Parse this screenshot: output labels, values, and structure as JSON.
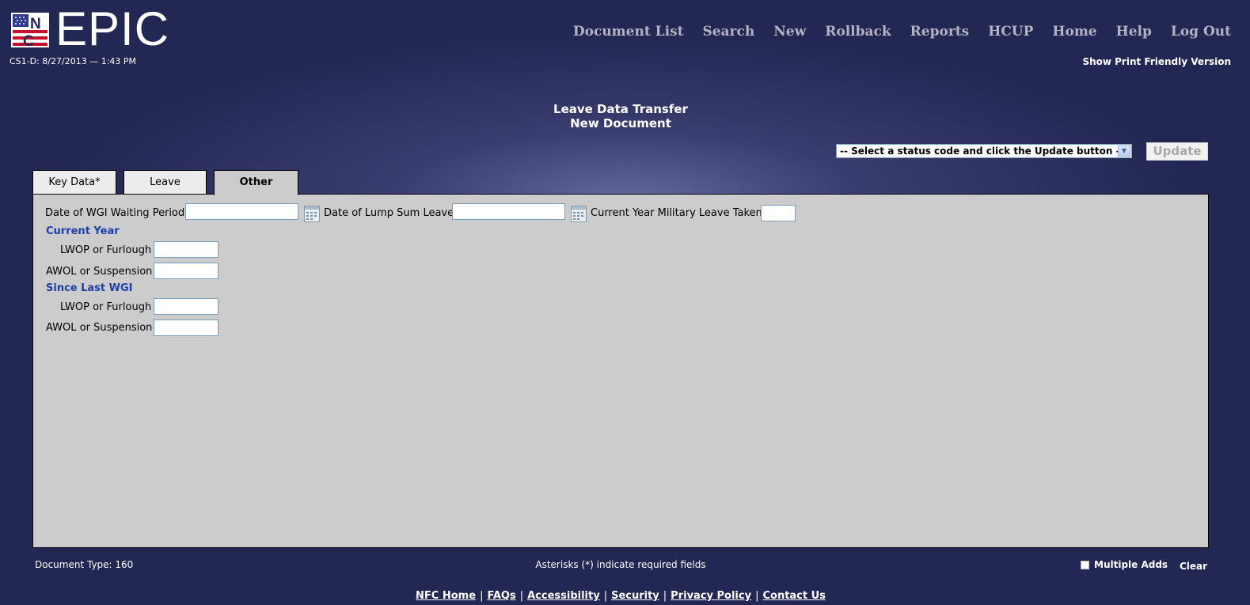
{
  "header": {
    "logo_text": "EPIC",
    "session": "CS1-D: 8/27/2013 — 1:43 PM",
    "nav": [
      "Document List",
      "Search",
      "New",
      "Rollback",
      "Reports",
      "HCUP",
      "Home",
      "Help",
      "Log Out"
    ],
    "print_link": "Show Print Friendly Version"
  },
  "page": {
    "title": "Leave Data Transfer",
    "subtitle": "New Document"
  },
  "status": {
    "select_value": "-- Select a status code and click the Update button --",
    "update_label": "Update"
  },
  "tabs": [
    {
      "label": "Key Data*",
      "active": false
    },
    {
      "label": "Leave",
      "active": false
    },
    {
      "label": "Other",
      "active": true
    }
  ],
  "form": {
    "wgi_waiting_label": "Date of WGI Waiting Period",
    "wgi_waiting_value": "",
    "lump_sum_label": "Date of Lump Sum Leave",
    "lump_sum_value": "",
    "military_label": "Current Year Military Leave Taken",
    "military_value": "",
    "current_year": {
      "heading": "Current Year",
      "lwop_label": "LWOP or Furlough",
      "lwop_value": "",
      "awol_label": "AWOL or Suspension",
      "awol_value": ""
    },
    "since_last_wgi": {
      "heading": "Since Last WGI",
      "lwop_label": "LWOP or Furlough",
      "lwop_value": "",
      "awol_label": "AWOL or Suspension",
      "awol_value": ""
    }
  },
  "footer": {
    "doc_type": "Document Type: 160",
    "required_note": "Asterisks (*) indicate required fields",
    "multiple_adds": "Multiple Adds",
    "clear": "Clear",
    "links": [
      "NFC Home",
      "FAQs",
      "Accessibility",
      "Security",
      "Privacy Policy",
      "Contact Us"
    ]
  },
  "colors": {
    "background": "#222753",
    "nav_text": "#b3b3c3",
    "section_heading": "#1c3fa8",
    "panel": "#cccccc"
  }
}
